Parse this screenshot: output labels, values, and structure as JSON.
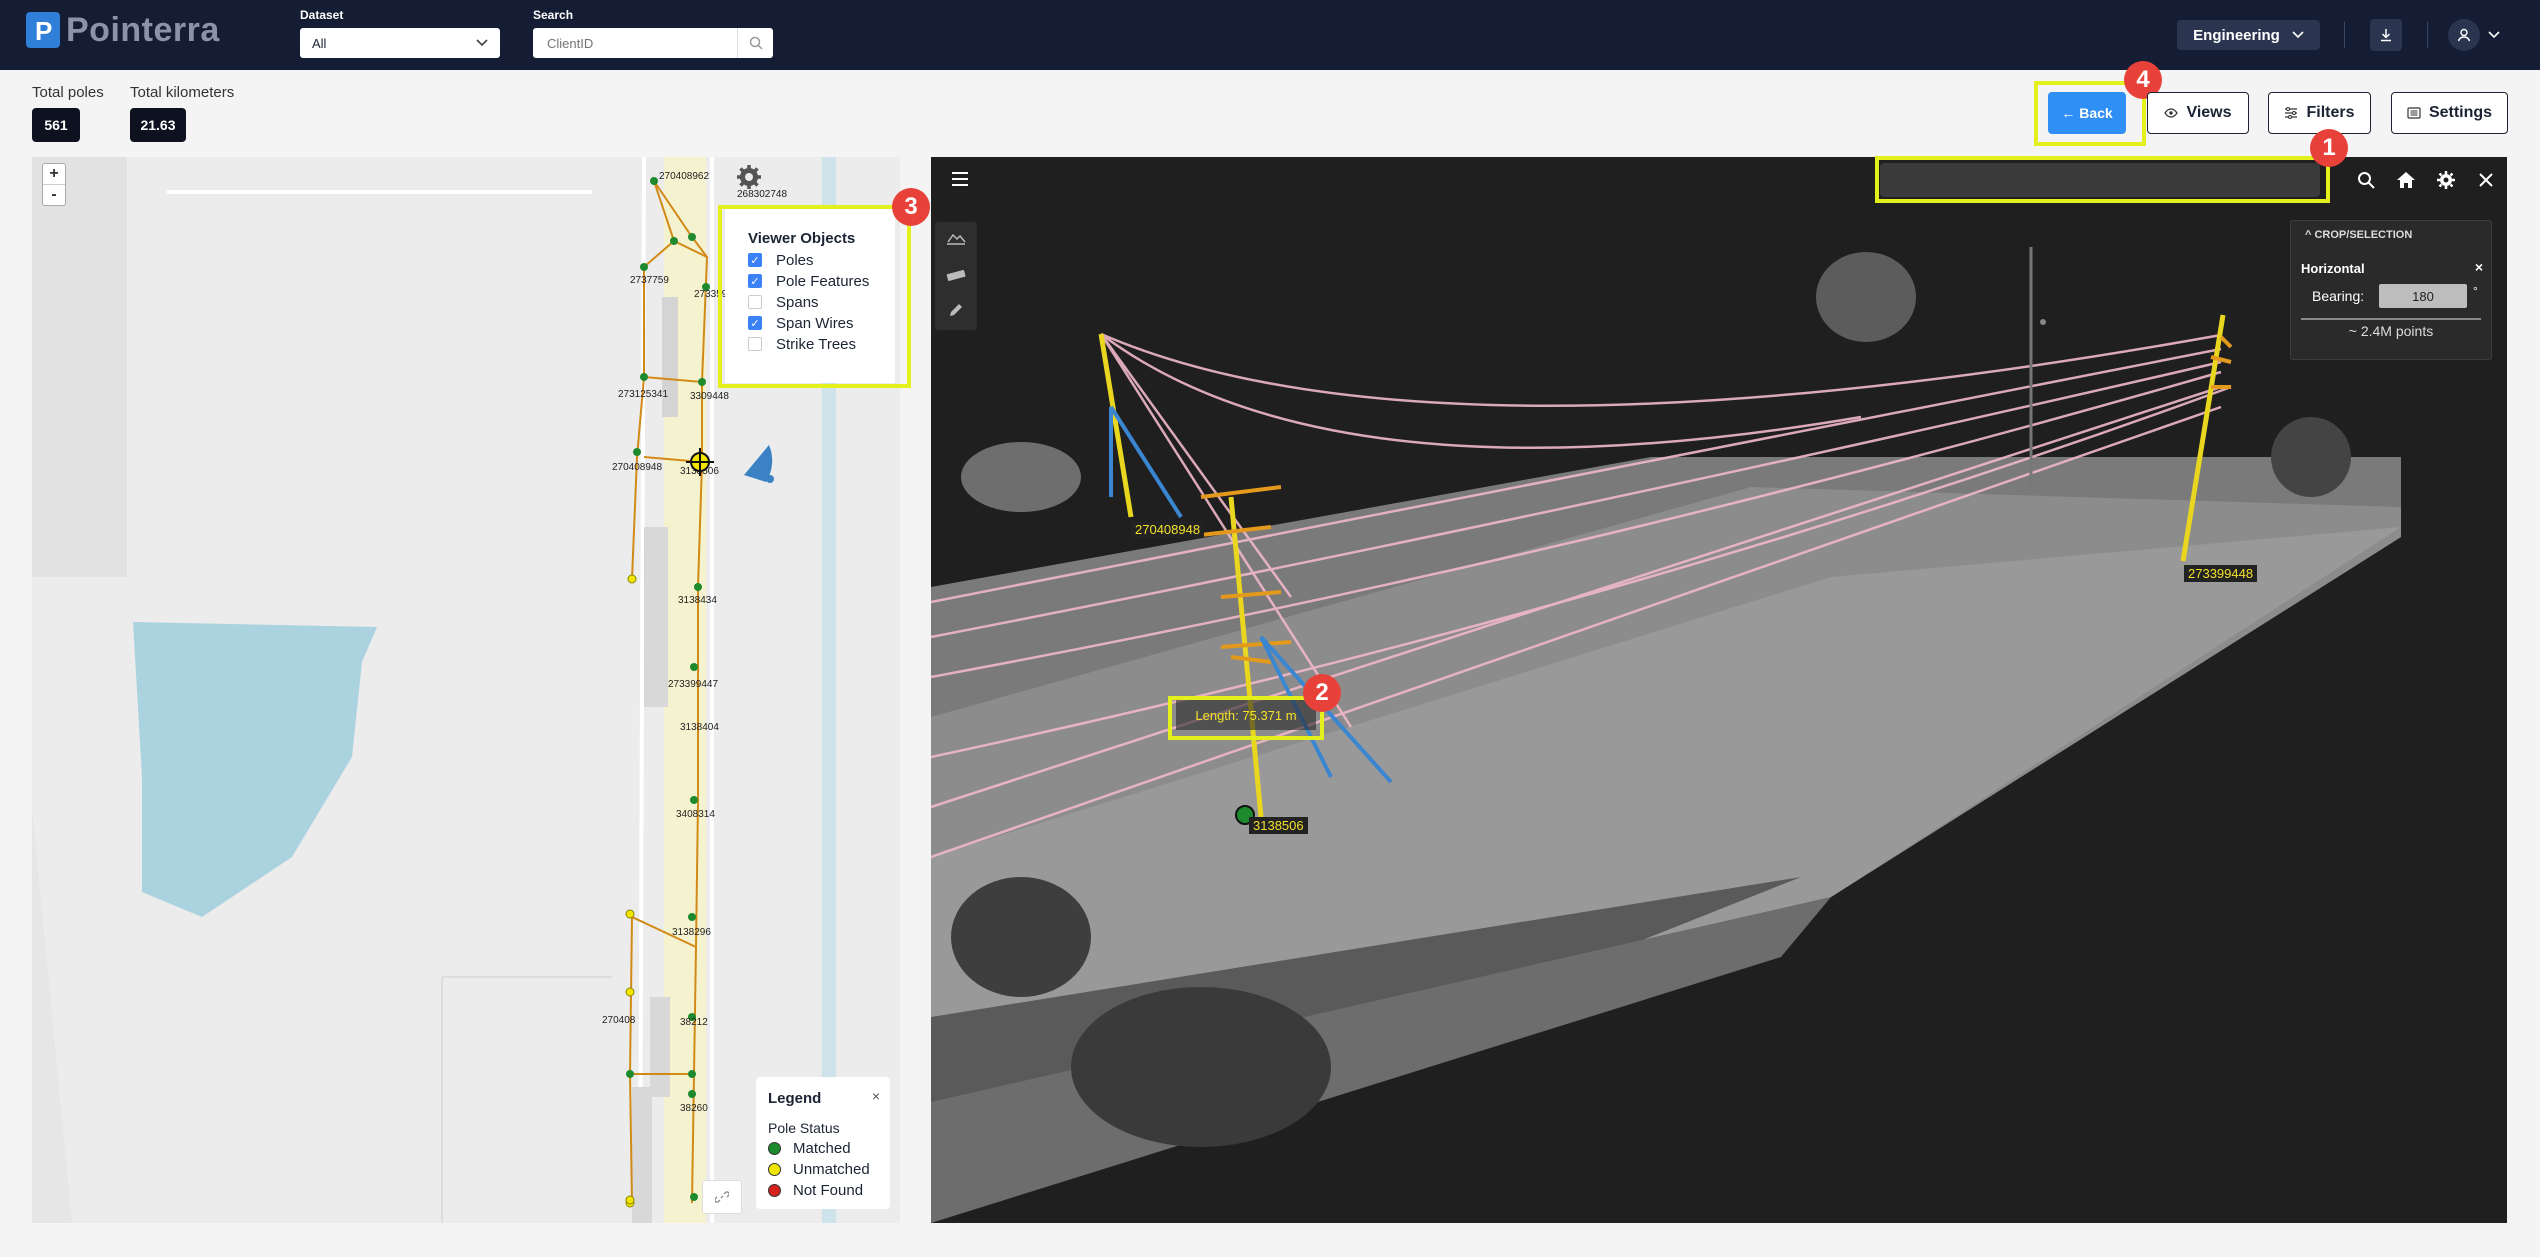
{
  "header": {
    "logo_letter": "P",
    "logo_text": "Pointerra",
    "dataset_label": "Dataset",
    "dataset_value": "All",
    "search_label": "Search",
    "search_placeholder": "ClientID",
    "workspace": "Engineering"
  },
  "stats": {
    "total_poles_label": "Total poles",
    "total_poles_value": "561",
    "total_km_label": "Total kilometers",
    "total_km_value": "21.63"
  },
  "actions": {
    "back": "← Back",
    "views": "Views",
    "filters": "Filters",
    "settings": "Settings"
  },
  "annotations": [
    "1",
    "2",
    "3",
    "4"
  ],
  "viewer_objects": {
    "title": "Viewer Objects",
    "items": [
      {
        "label": "Poles",
        "checked": true
      },
      {
        "label": "Pole Features",
        "checked": true
      },
      {
        "label": "Spans",
        "checked": false
      },
      {
        "label": "Span Wires",
        "checked": true
      },
      {
        "label": "Strike Trees",
        "checked": false
      }
    ]
  },
  "map": {
    "zoom_in": "+",
    "zoom_out": "-",
    "pole_ids": [
      "270408962",
      "268302748",
      "2737759",
      "2733594",
      "273125341",
      "3309448",
      "270408948",
      "3138506",
      "3138434",
      "273399447",
      "3138404",
      "3408314",
      "3138296",
      "270408",
      "38212",
      "38260"
    ]
  },
  "legend": {
    "title": "Legend",
    "close": "×",
    "subtitle": "Pole Status",
    "items": [
      {
        "label": "Matched",
        "color": "#1e8a2e"
      },
      {
        "label": "Unmatched",
        "color": "#f2e600"
      },
      {
        "label": "Not Found",
        "color": "#d61f1f"
      }
    ]
  },
  "viewer": {
    "crop_header": "CROP/SELECTION",
    "crop_mode": "Horizontal",
    "crop_close": "×",
    "bearing_label": "Bearing:",
    "bearing_value": "180",
    "bearing_unit": "°",
    "points": "~ 2.4M points",
    "measure_text": "Length: 75.371 m",
    "pole_labels": [
      "270408948",
      "273399448",
      "3138506"
    ]
  },
  "colors": {
    "header_bg": "#141d33",
    "accent": "#2f8ff5",
    "highlight": "#e4f01c",
    "badge": "#e8413a"
  }
}
